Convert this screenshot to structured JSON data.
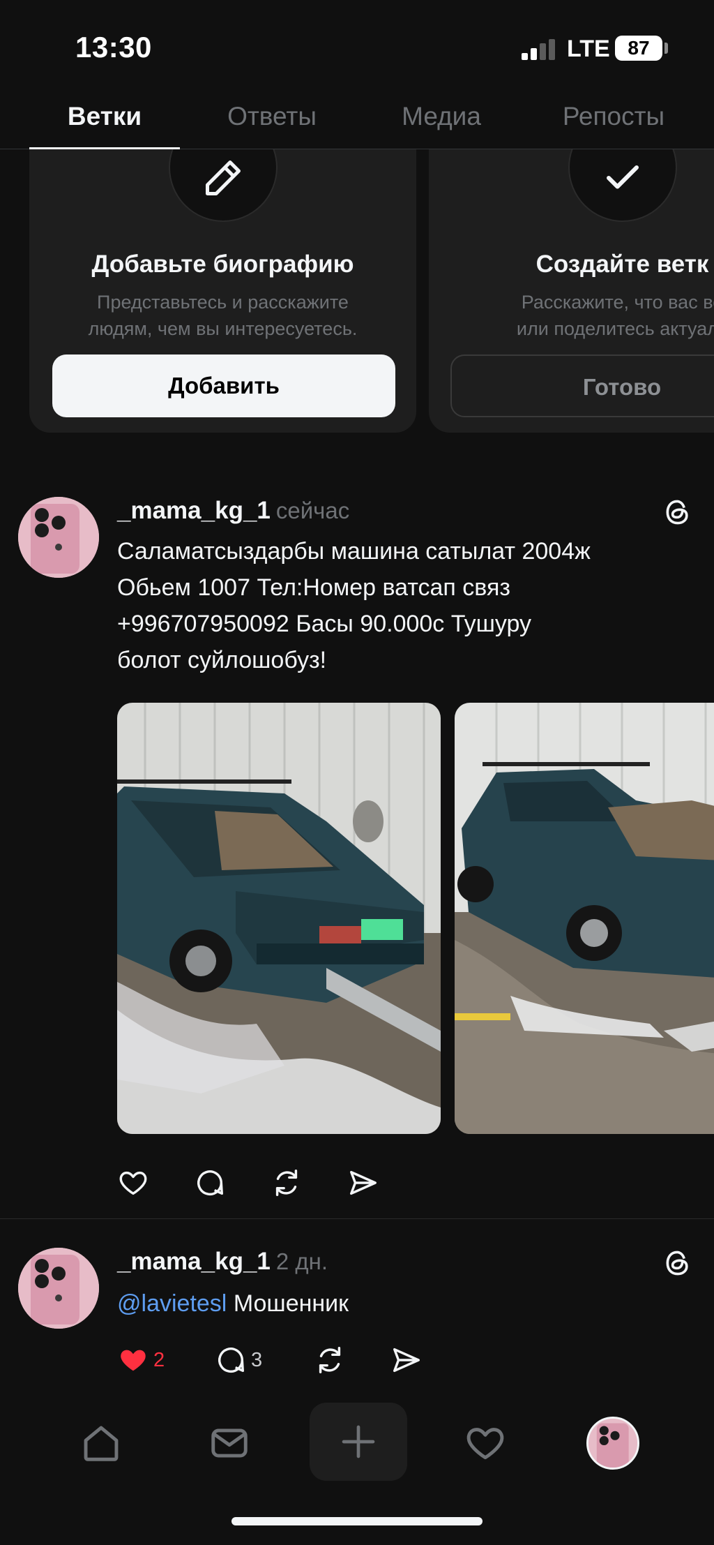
{
  "status_bar": {
    "time": "13:30",
    "network": "LTE",
    "battery": "87"
  },
  "tabs": [
    {
      "label": "Ветки",
      "active": true
    },
    {
      "label": "Ответы",
      "active": false
    },
    {
      "label": "Медиа",
      "active": false
    },
    {
      "label": "Репосты",
      "active": false
    }
  ],
  "cards": [
    {
      "icon": "pencil-icon",
      "title": "Добавьте биографию",
      "description_line1": "Представьтесь и расскажите",
      "description_line2": "людям, чем вы интересуетесь.",
      "button": "Добавить"
    },
    {
      "icon": "checkmark-icon",
      "title": "Создайте ветк",
      "description_line1": "Расскажите, что вас во",
      "description_line2": "или поделитесь актуаль",
      "button": "Готово"
    }
  ],
  "posts": [
    {
      "username": "_mama_kg_1",
      "time": "сейчас",
      "text_lines": [
        "Саламатсыздарбы машина сатылат  2004ж",
        "Обьем 1007 Тел:Номер ватсап связ",
        "+996707950092 Басы 90.000с Тушуру",
        "болот суйлошобуз!"
      ],
      "photos": [
        "car-photo-rear",
        "car-photo-side"
      ]
    },
    {
      "username": "_mama_kg_1",
      "time": "2 дн.",
      "mention": "@lavietesl",
      "text": "Мошенник",
      "likes": "2",
      "replies": "3"
    }
  ],
  "colors": {
    "background": "#101010",
    "card": "#1e1e1e",
    "text": "#f3f5f7",
    "muted": "#6f7276",
    "mention": "#5e9df0",
    "like": "#ff3040"
  },
  "bottom_nav": [
    "home-icon",
    "inbox-icon",
    "plus-icon",
    "heart-icon",
    "profile-avatar"
  ]
}
